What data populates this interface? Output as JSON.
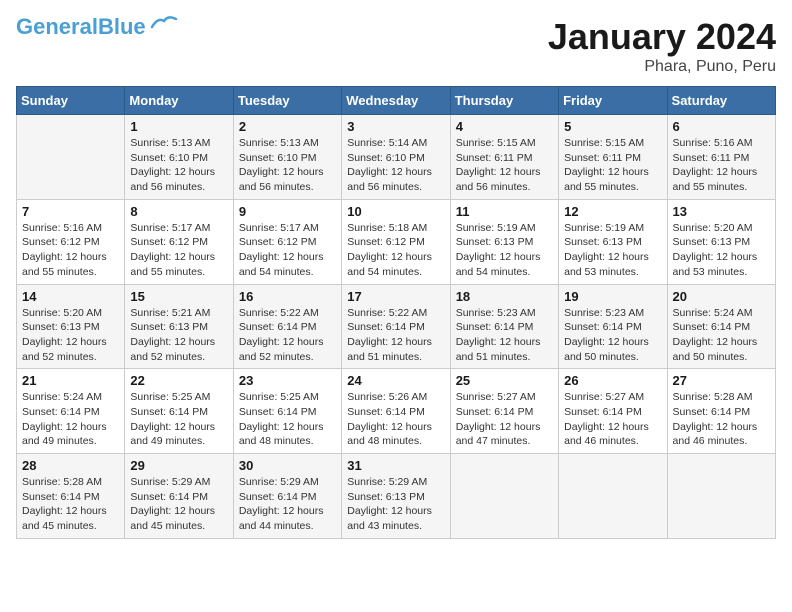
{
  "header": {
    "logo_line1": "General",
    "logo_line2": "Blue",
    "month_title": "January 2024",
    "subtitle": "Phara, Puno, Peru"
  },
  "days_of_week": [
    "Sunday",
    "Monday",
    "Tuesday",
    "Wednesday",
    "Thursday",
    "Friday",
    "Saturday"
  ],
  "weeks": [
    [
      {
        "day": "",
        "info": ""
      },
      {
        "day": "1",
        "info": "Sunrise: 5:13 AM\nSunset: 6:10 PM\nDaylight: 12 hours\nand 56 minutes."
      },
      {
        "day": "2",
        "info": "Sunrise: 5:13 AM\nSunset: 6:10 PM\nDaylight: 12 hours\nand 56 minutes."
      },
      {
        "day": "3",
        "info": "Sunrise: 5:14 AM\nSunset: 6:10 PM\nDaylight: 12 hours\nand 56 minutes."
      },
      {
        "day": "4",
        "info": "Sunrise: 5:15 AM\nSunset: 6:11 PM\nDaylight: 12 hours\nand 56 minutes."
      },
      {
        "day": "5",
        "info": "Sunrise: 5:15 AM\nSunset: 6:11 PM\nDaylight: 12 hours\nand 55 minutes."
      },
      {
        "day": "6",
        "info": "Sunrise: 5:16 AM\nSunset: 6:11 PM\nDaylight: 12 hours\nand 55 minutes."
      }
    ],
    [
      {
        "day": "7",
        "info": "Sunrise: 5:16 AM\nSunset: 6:12 PM\nDaylight: 12 hours\nand 55 minutes."
      },
      {
        "day": "8",
        "info": "Sunrise: 5:17 AM\nSunset: 6:12 PM\nDaylight: 12 hours\nand 55 minutes."
      },
      {
        "day": "9",
        "info": "Sunrise: 5:17 AM\nSunset: 6:12 PM\nDaylight: 12 hours\nand 54 minutes."
      },
      {
        "day": "10",
        "info": "Sunrise: 5:18 AM\nSunset: 6:12 PM\nDaylight: 12 hours\nand 54 minutes."
      },
      {
        "day": "11",
        "info": "Sunrise: 5:19 AM\nSunset: 6:13 PM\nDaylight: 12 hours\nand 54 minutes."
      },
      {
        "day": "12",
        "info": "Sunrise: 5:19 AM\nSunset: 6:13 PM\nDaylight: 12 hours\nand 53 minutes."
      },
      {
        "day": "13",
        "info": "Sunrise: 5:20 AM\nSunset: 6:13 PM\nDaylight: 12 hours\nand 53 minutes."
      }
    ],
    [
      {
        "day": "14",
        "info": "Sunrise: 5:20 AM\nSunset: 6:13 PM\nDaylight: 12 hours\nand 52 minutes."
      },
      {
        "day": "15",
        "info": "Sunrise: 5:21 AM\nSunset: 6:13 PM\nDaylight: 12 hours\nand 52 minutes."
      },
      {
        "day": "16",
        "info": "Sunrise: 5:22 AM\nSunset: 6:14 PM\nDaylight: 12 hours\nand 52 minutes."
      },
      {
        "day": "17",
        "info": "Sunrise: 5:22 AM\nSunset: 6:14 PM\nDaylight: 12 hours\nand 51 minutes."
      },
      {
        "day": "18",
        "info": "Sunrise: 5:23 AM\nSunset: 6:14 PM\nDaylight: 12 hours\nand 51 minutes."
      },
      {
        "day": "19",
        "info": "Sunrise: 5:23 AM\nSunset: 6:14 PM\nDaylight: 12 hours\nand 50 minutes."
      },
      {
        "day": "20",
        "info": "Sunrise: 5:24 AM\nSunset: 6:14 PM\nDaylight: 12 hours\nand 50 minutes."
      }
    ],
    [
      {
        "day": "21",
        "info": "Sunrise: 5:24 AM\nSunset: 6:14 PM\nDaylight: 12 hours\nand 49 minutes."
      },
      {
        "day": "22",
        "info": "Sunrise: 5:25 AM\nSunset: 6:14 PM\nDaylight: 12 hours\nand 49 minutes."
      },
      {
        "day": "23",
        "info": "Sunrise: 5:25 AM\nSunset: 6:14 PM\nDaylight: 12 hours\nand 48 minutes."
      },
      {
        "day": "24",
        "info": "Sunrise: 5:26 AM\nSunset: 6:14 PM\nDaylight: 12 hours\nand 48 minutes."
      },
      {
        "day": "25",
        "info": "Sunrise: 5:27 AM\nSunset: 6:14 PM\nDaylight: 12 hours\nand 47 minutes."
      },
      {
        "day": "26",
        "info": "Sunrise: 5:27 AM\nSunset: 6:14 PM\nDaylight: 12 hours\nand 46 minutes."
      },
      {
        "day": "27",
        "info": "Sunrise: 5:28 AM\nSunset: 6:14 PM\nDaylight: 12 hours\nand 46 minutes."
      }
    ],
    [
      {
        "day": "28",
        "info": "Sunrise: 5:28 AM\nSunset: 6:14 PM\nDaylight: 12 hours\nand 45 minutes."
      },
      {
        "day": "29",
        "info": "Sunrise: 5:29 AM\nSunset: 6:14 PM\nDaylight: 12 hours\nand 45 minutes."
      },
      {
        "day": "30",
        "info": "Sunrise: 5:29 AM\nSunset: 6:14 PM\nDaylight: 12 hours\nand 44 minutes."
      },
      {
        "day": "31",
        "info": "Sunrise: 5:29 AM\nSunset: 6:13 PM\nDaylight: 12 hours\nand 43 minutes."
      },
      {
        "day": "",
        "info": ""
      },
      {
        "day": "",
        "info": ""
      },
      {
        "day": "",
        "info": ""
      }
    ]
  ]
}
